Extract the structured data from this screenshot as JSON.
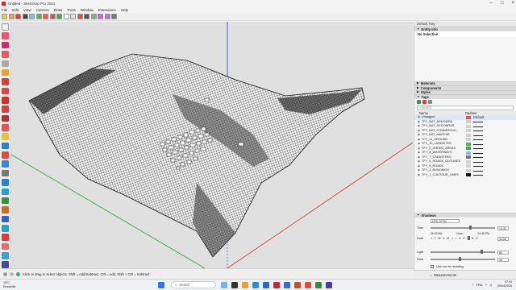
{
  "window": {
    "title": "Untitled - SketchUp Pro 2021"
  },
  "menu": [
    "File",
    "Edit",
    "View",
    "Camera",
    "Draw",
    "Tools",
    "Window",
    "Extensions",
    "Help"
  ],
  "tray": {
    "header": "Default Tray",
    "entity_info": {
      "label": "Entity Info",
      "selection": "No Selection"
    },
    "collapsed_panels": [
      "Materials",
      "Components",
      "Styles"
    ],
    "tags": {
      "label": "Tags",
      "search_placeholder": "Search",
      "col_name": "Name",
      "col_dashes": "Dashes",
      "rows": [
        {
          "name": "Untagged",
          "color": "#e44c5a",
          "dash": "Default",
          "selected": true
        },
        {
          "name": "TFY_BAT_ARUGIERA",
          "color": "#cfcfcf"
        },
        {
          "name": "TFY_BAT_DEGOBROS",
          "color": "#cfcfcf"
        },
        {
          "name": "TFY_BAT_COMMERCIA...",
          "color": "#cfcfcf"
        },
        {
          "name": "TFY_BAT_MARCHE",
          "color": "#cfcfcf"
        },
        {
          "name": "TFY_11_GROUND",
          "color": "#cfcfcf"
        },
        {
          "name": "TFY_10_LANDSITES",
          "color": "#4fb04f"
        },
        {
          "name": "TFY_9_GREEN_AREAS",
          "color": "#3da84a"
        },
        {
          "name": "TFY_8_WATERWAYS",
          "color": "#8fb8d8"
        },
        {
          "name": "TFY_7_CADASTRES",
          "color": "#777777"
        },
        {
          "name": "TFY_6_ROADS_OUTLINES",
          "color": "#cfcfcf"
        },
        {
          "name": "TFY_5_ROADS",
          "color": "#cfcfcf"
        },
        {
          "name": "TFY_3_BUILDINGS",
          "color": "#cfcfcf"
        },
        {
          "name": "TFY_1_CONTOUR_LINES",
          "color": "#111111"
        }
      ]
    },
    "shadows": {
      "label": "Shadows",
      "utc": "UTC-07:00",
      "time_label": "Time",
      "time_start": "06:43 AM",
      "time_noon": "Noon",
      "time_end": "04:46 PM",
      "time_value": "13:30",
      "date_label": "Date",
      "months": "J F M A M J J A S O N D",
      "date_value": "11/08",
      "light_label": "Light",
      "light_value": "80",
      "dark_label": "Dark",
      "dark_value": "45",
      "use_sun_label": "Use sun for shading",
      "time_level": 0.62,
      "date_level": 0.6,
      "light_level": 0.8,
      "dark_level": 0.45
    }
  },
  "status": {
    "hint": "Click or drag to select objects. Shift = Add/Subtract. Ctrl = Add. Shift + Ctrl = Subtract."
  },
  "measurements": {
    "label": "Measurements"
  },
  "taskbar": {
    "weather_temp": "15°C",
    "weather_desc": "Ensoleillé",
    "search_placeholder": "Search",
    "time": "07:03",
    "date": "25/04/2025",
    "lang": "FRA"
  },
  "colors": {
    "accent": "#c8282e",
    "blue_axis": "#3838c8",
    "red_axis": "#d03030",
    "green_axis": "#30a030"
  }
}
